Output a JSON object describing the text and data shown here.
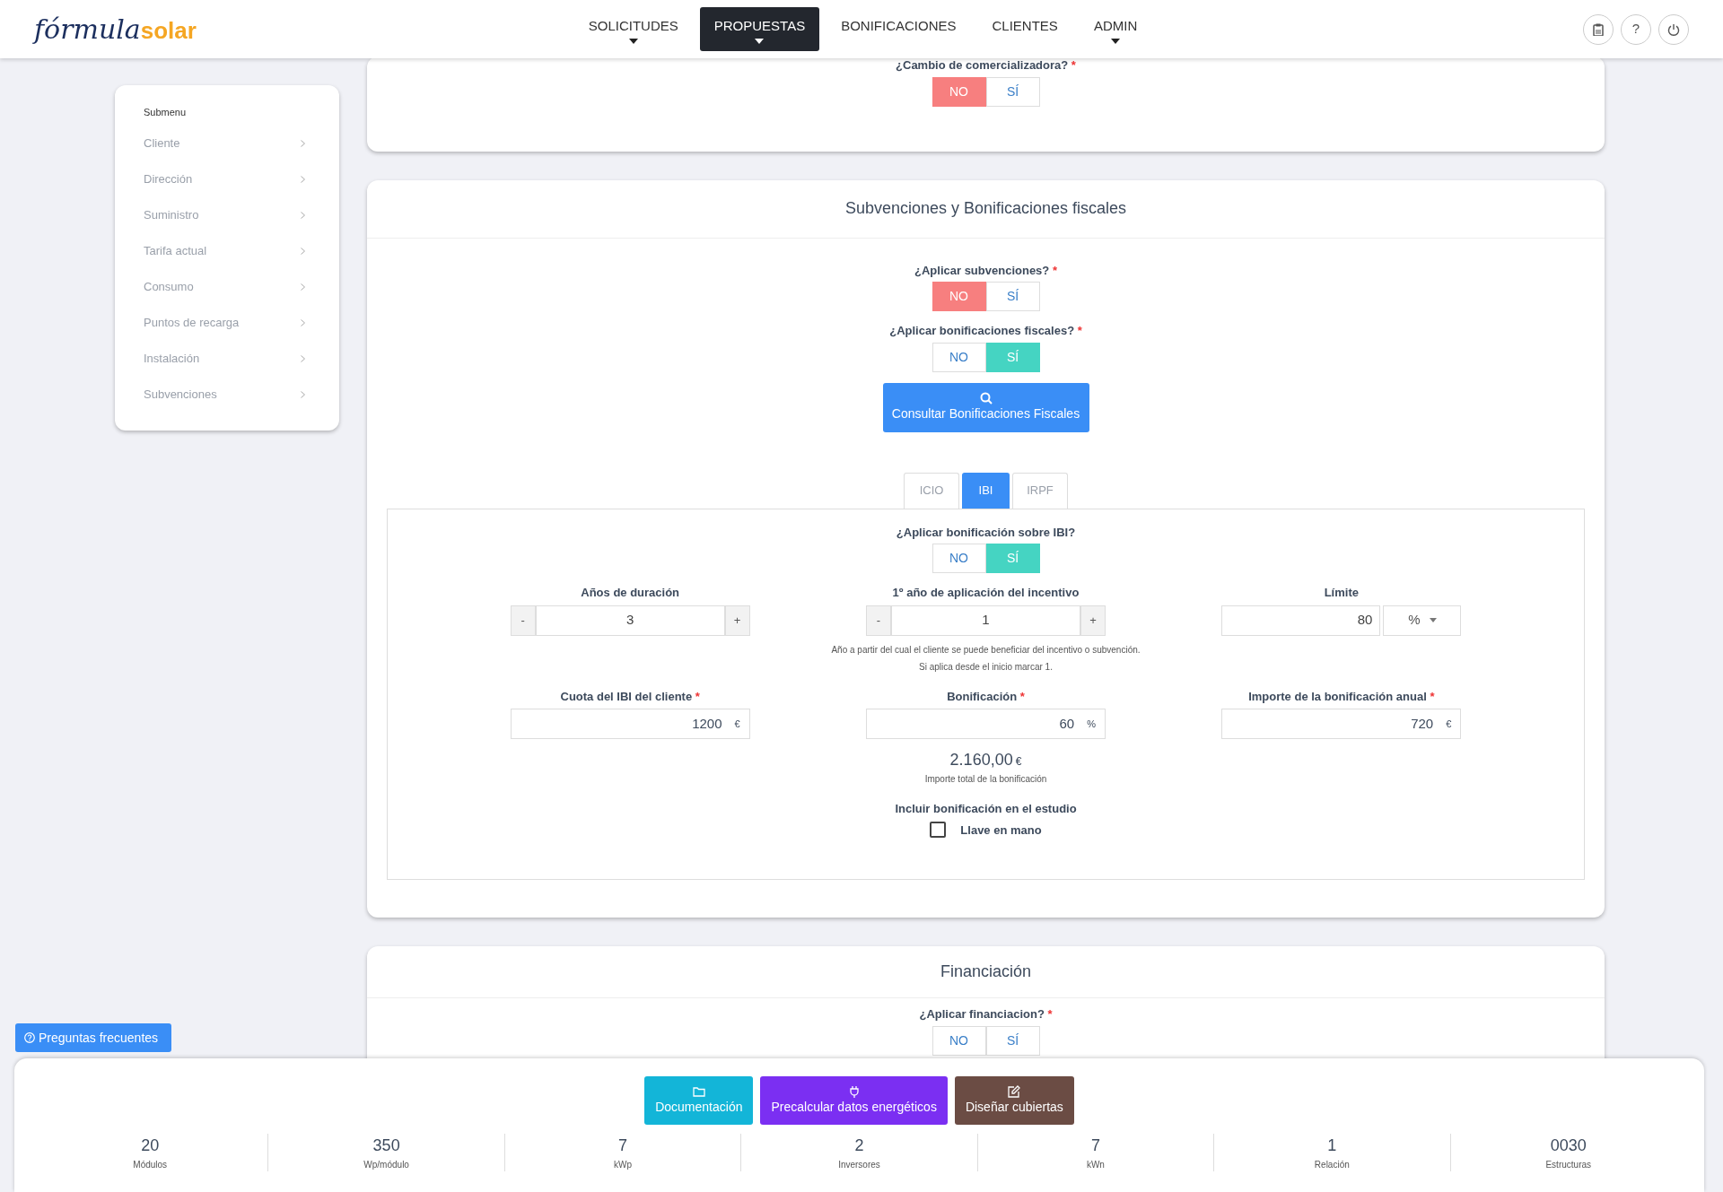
{
  "header": {
    "logo": {
      "first": "fórmula",
      "second": "solar"
    },
    "nav": [
      {
        "label": "SOLICITUDES",
        "selected": false,
        "dropdown": true
      },
      {
        "label": "PROPUESTAS",
        "selected": true,
        "dropdown": true
      },
      {
        "label": "BONIFICACIONES",
        "selected": false,
        "dropdown": false
      },
      {
        "label": "CLIENTES",
        "selected": false,
        "dropdown": false
      },
      {
        "label": "ADMIN",
        "selected": false,
        "dropdown": true
      }
    ],
    "help_label": "?"
  },
  "sidebar": {
    "title": "Submenu",
    "items": [
      "Cliente",
      "Dirección",
      "Suministro",
      "Tarifa actual",
      "Consumo",
      "Puntos de recarga",
      "Instalación",
      "Subvenciones"
    ]
  },
  "faq_button": "Preguntas frecuentes",
  "top_card": {
    "question": {
      "label": "¿Cambio de comercializadora?",
      "required_mark": "*",
      "options": [
        {
          "label": "NO",
          "kind": "no",
          "selected": true
        },
        {
          "label": "SÍ",
          "kind": "yes",
          "selected": false
        }
      ]
    }
  },
  "subsidies_card": {
    "title": "Subvenciones y Bonificaciones fiscales",
    "questions": [
      {
        "label": "¿Aplicar subvenciones?",
        "required_mark": "*",
        "options": [
          {
            "label": "NO",
            "kind": "no",
            "selected": true
          },
          {
            "label": "SÍ",
            "kind": "yes",
            "selected": false
          }
        ]
      },
      {
        "label": "¿Aplicar bonificaciones fiscales?",
        "required_mark": "*",
        "options": [
          {
            "label": "NO",
            "kind": "no",
            "selected": false
          },
          {
            "label": "SÍ",
            "kind": "yes",
            "selected": true
          }
        ]
      }
    ],
    "consult_button": "Consultar Bonificaciones Fiscales",
    "tabs": [
      {
        "label": "ICIO",
        "selected": false
      },
      {
        "label": "IBI",
        "selected": true
      },
      {
        "label": "IRPF",
        "selected": false
      }
    ],
    "panel": {
      "question": {
        "label": "¿Aplicar bonificación sobre IBI?",
        "options": [
          {
            "label": "NO",
            "kind": "no",
            "selected": false
          },
          {
            "label": "SÍ",
            "kind": "yes",
            "selected": true
          }
        ]
      },
      "fields": [
        {
          "kind": "stepper",
          "label": "Años de duración",
          "value": "3",
          "minus": "-",
          "plus": "+"
        },
        {
          "kind": "stepper",
          "label": "1º año de aplicación del incentivo",
          "value": "1",
          "minus": "-",
          "plus": "+",
          "help": [
            "Año a partir del cual el cliente se puede beneficiar del incentivo o subvención.",
            "Si aplica desde el inicio marcar 1."
          ]
        },
        {
          "kind": "select",
          "label": "Límite",
          "value": "80",
          "unit": "%"
        },
        {
          "kind": "unit",
          "label": "Cuota del IBI del cliente",
          "required_mark": "*",
          "value": "1200",
          "unit": "€"
        },
        {
          "kind": "unit",
          "label": "Bonificación",
          "required_mark": "*",
          "value": "60",
          "unit": "%"
        },
        {
          "kind": "unit",
          "label": "Importe de la bonificación anual",
          "required_mark": "*",
          "value": "720",
          "unit": "€"
        }
      ],
      "total": {
        "value": "2.160,00",
        "unit": "€",
        "caption": "Importe total de la bonificación"
      },
      "include": {
        "label": "Incluir bonificación en el estudio",
        "checkbox": {
          "label": "Llave en mano",
          "checked": false
        }
      }
    }
  },
  "financing_card": {
    "title": "Financiación",
    "question": {
      "label": "¿Aplicar financiacion?",
      "required_mark": "*",
      "options": [
        {
          "label": "NO",
          "selected": false
        },
        {
          "label": "SÍ",
          "selected": false
        }
      ]
    }
  },
  "bottom_bar": {
    "buttons": [
      {
        "label": "Documentación",
        "kind": "docs"
      },
      {
        "label": "Precalcular datos energéticos",
        "kind": "energy"
      },
      {
        "label": "Diseñar cubiertas",
        "kind": "design"
      }
    ],
    "stats": [
      {
        "value": "20",
        "label": "Módulos"
      },
      {
        "value": "350",
        "label": "Wp/módulo"
      },
      {
        "value": "7",
        "label": "kWp"
      },
      {
        "value": "2",
        "label": "Inversores"
      },
      {
        "value": "7",
        "label": "kWn"
      },
      {
        "value": "1",
        "label": "Relación"
      },
      {
        "value": "0030",
        "label": "Estructuras"
      }
    ]
  }
}
